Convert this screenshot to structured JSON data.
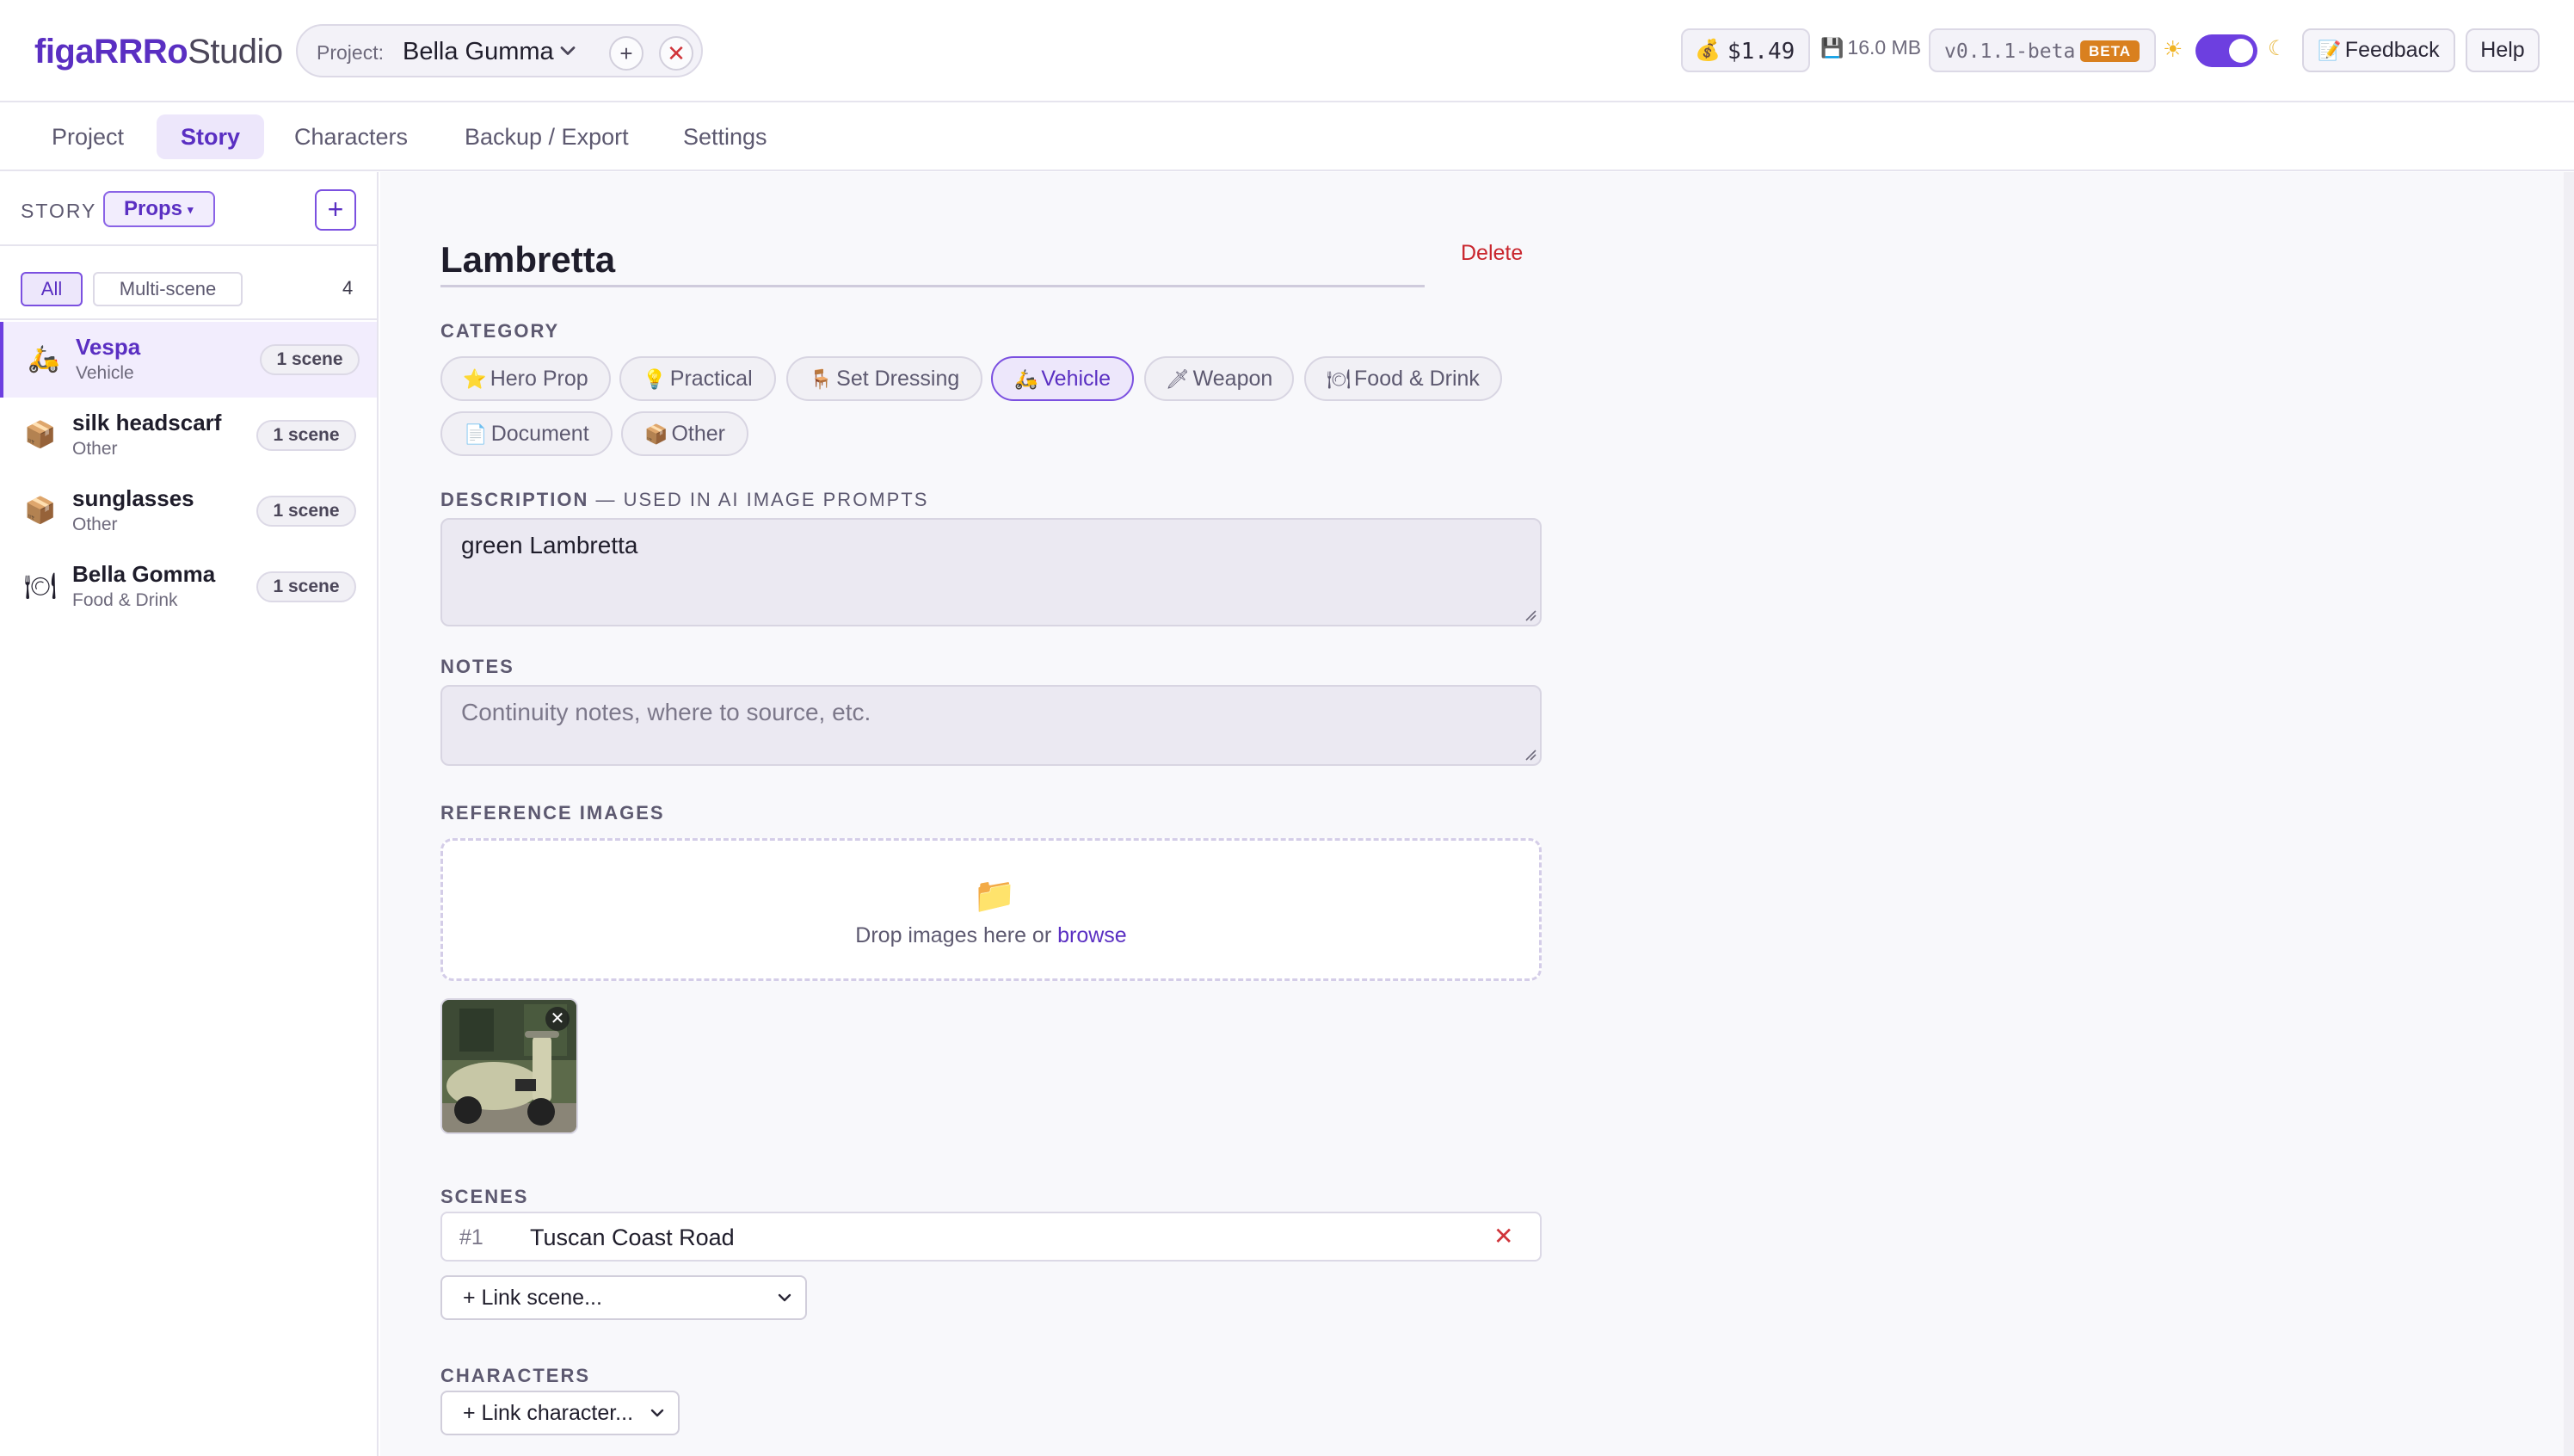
{
  "header": {
    "brand_bold": "figaRRRo",
    "brand_light": "Studio",
    "project_label": "Project:",
    "project_name": "Bella Gumma",
    "add_symbol": "+",
    "close_symbol": "✕",
    "cost_icon": "money-bag-icon",
    "cost": "$1.49",
    "storage_icon": "floppy-disk-icon",
    "storage": "16.0 MB",
    "version": "v0.1.1-beta",
    "beta_badge": "BETA",
    "theme_dark_enabled": true,
    "feedback_label": "Feedback",
    "help_label": "Help"
  },
  "tabs": [
    {
      "label": "Project",
      "active": false
    },
    {
      "label": "Story",
      "active": true
    },
    {
      "label": "Characters",
      "active": false
    },
    {
      "label": "Backup / Export",
      "active": false
    },
    {
      "label": "Settings",
      "active": false
    }
  ],
  "sidebar": {
    "section_label": "STORY",
    "type_select": "Props",
    "add_symbol": "+",
    "filters": {
      "all": "All",
      "multi": "Multi-scene",
      "count": "4"
    },
    "items": [
      {
        "icon": "🛵",
        "icon_name": "scooter-icon",
        "name": "Vespa",
        "category": "Vehicle",
        "badge": "1 scene",
        "active": true
      },
      {
        "icon": "📦",
        "icon_name": "package-icon",
        "name": "silk headscarf",
        "category": "Other",
        "badge": "1 scene",
        "active": false
      },
      {
        "icon": "📦",
        "icon_name": "package-icon",
        "name": "sunglasses",
        "category": "Other",
        "badge": "1 scene",
        "active": false
      },
      {
        "icon": "🍽",
        "icon_name": "plate-icon",
        "name": "Bella Gomma",
        "category": "Food & Drink",
        "badge": "1 scene",
        "active": false
      }
    ]
  },
  "detail": {
    "title": "Lambretta",
    "delete_label": "Delete",
    "category_label": "CATEGORY",
    "categories": [
      {
        "icon": "⭐",
        "label": "Hero Prop",
        "active": false
      },
      {
        "icon": "💡",
        "label": "Practical",
        "active": false
      },
      {
        "icon": "🪑",
        "label": "Set Dressing",
        "active": false
      },
      {
        "icon": "🛵",
        "label": "Vehicle",
        "active": true
      },
      {
        "icon": "🗡",
        "label": "Weapon",
        "active": false
      },
      {
        "icon": "🍽",
        "label": "Food & Drink",
        "active": false
      },
      {
        "icon": "📄",
        "label": "Document",
        "active": false
      },
      {
        "icon": "📦",
        "label": "Other",
        "active": false
      }
    ],
    "description_label": "DESCRIPTION",
    "description_hint": " — USED IN AI IMAGE PROMPTS",
    "description_value": "green Lambretta",
    "notes_label": "NOTES",
    "notes_placeholder": "Continuity notes, where to source, etc.",
    "ref_label": "REFERENCE IMAGES",
    "drop_text": "Drop images here or ",
    "browse_link": "browse",
    "thumb_remove": "✕",
    "scenes_label": "SCENES",
    "scenes": [
      {
        "num": "#1",
        "name": "Tuscan Coast Road"
      }
    ],
    "link_scene": "+ Link scene...",
    "characters_label": "CHARACTERS",
    "link_character": "+ Link character..."
  },
  "colors": {
    "accent": "#6d3fe0",
    "danger": "#c9252d",
    "beta": "#d9801f"
  }
}
